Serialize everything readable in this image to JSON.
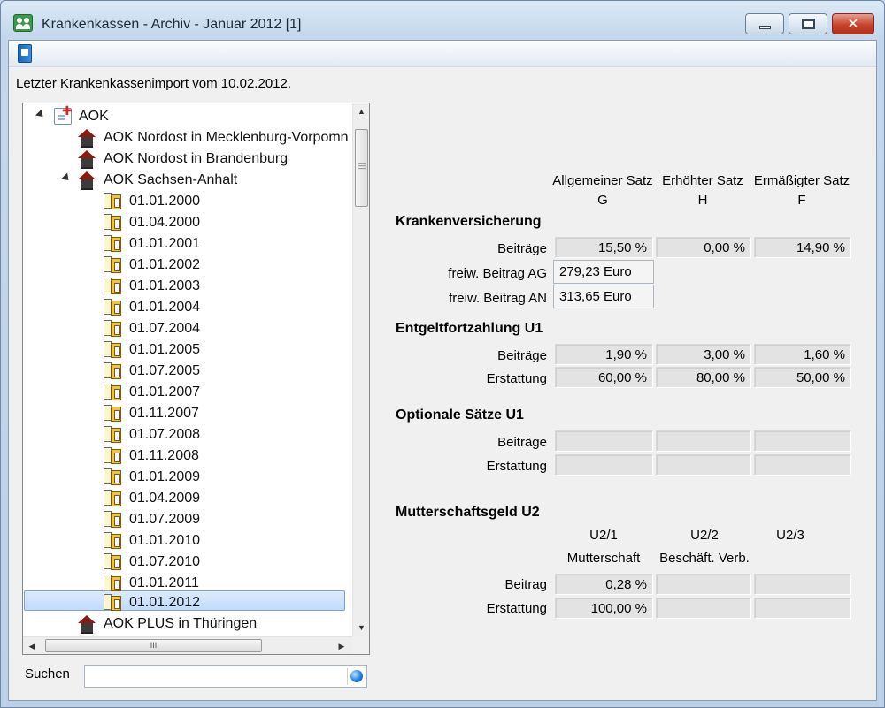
{
  "window": {
    "title": "Krankenkassen - Archiv - Januar 2012 [1]",
    "close_glyph": "✕"
  },
  "info": {
    "import_text": "Letzter Krankenkassenimport vom 10.02.2012."
  },
  "tree": {
    "root": "AOK",
    "children": [
      "AOK Nordost in Mecklenburg-Vorpomn",
      "AOK Nordost in Brandenburg",
      "AOK Sachsen-Anhalt"
    ],
    "dates": [
      "01.01.2000",
      "01.04.2000",
      "01.01.2001",
      "01.01.2002",
      "01.01.2003",
      "01.01.2004",
      "01.07.2004",
      "01.01.2005",
      "01.07.2005",
      "01.01.2007",
      "01.11.2007",
      "01.07.2008",
      "01.11.2008",
      "01.01.2009",
      "01.04.2009",
      "01.07.2009",
      "01.01.2010",
      "01.07.2010",
      "01.01.2011",
      "01.01.2012"
    ],
    "selected": "01.01.2012",
    "after": "AOK PLUS in Thüringen"
  },
  "scroll": {
    "up": "▲",
    "down": "▼",
    "left": "◀",
    "right": "▶",
    "grip_h": "III"
  },
  "search": {
    "label": "Suchen",
    "value": ""
  },
  "columns": {
    "g_top": "Allgemeiner Satz",
    "g_bottom": "G",
    "h_top": "Erhöhter Satz",
    "h_bottom": "H",
    "f_top": "Ermäßigter Satz",
    "f_bottom": "F"
  },
  "kv": {
    "heading": "Krankenversicherung",
    "beitraege_label": "Beiträge",
    "g": "15,50 %",
    "h": "0,00 %",
    "f": "14,90 %",
    "ag_label": "freiw. Beitrag AG",
    "ag_value": "279,23 Euro",
    "an_label": "freiw. Beitrag AN",
    "an_value": "313,65 Euro"
  },
  "u1": {
    "heading": "Entgeltfortzahlung  U1",
    "beitraege_label": "Beiträge",
    "beitraege": [
      "1,90 %",
      "3,00 %",
      "1,60 %"
    ],
    "erstattung_label": "Erstattung",
    "erstattung": [
      "60,00 %",
      "80,00 %",
      "50,00 %"
    ]
  },
  "opt": {
    "heading": "Optionale Sätze U1",
    "beitraege_label": "Beiträge",
    "erstattung_label": "Erstattung"
  },
  "u2": {
    "heading": "Mutterschaftsgeld  U2",
    "col1_top": "U2/1",
    "col1_bottom": "Mutterschaft",
    "col2_top": "U2/2",
    "col2_bottom": "Beschäft. Verb.",
    "col3_top": "U2/3",
    "beitrag_label": "Beitrag",
    "beitrag": "0,28 %",
    "erstattung_label": "Erstattung",
    "erstattung": "100,00 %"
  }
}
